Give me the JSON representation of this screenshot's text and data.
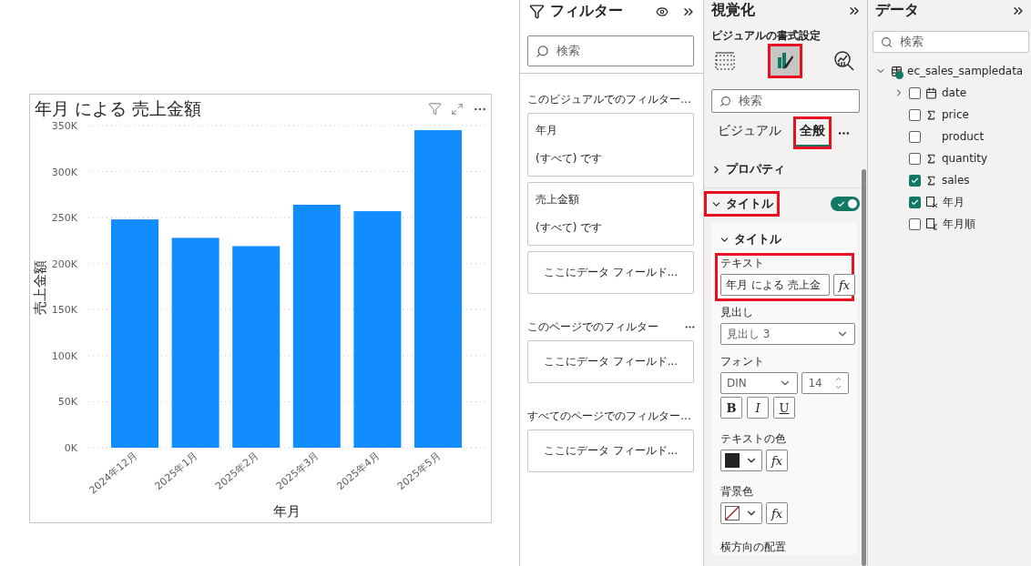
{
  "canvas": {
    "visual": {
      "title": "年月 による 売上金額",
      "chart_data": {
        "type": "bar",
        "xlabel": "年月",
        "ylabel": "売上金額",
        "categories": [
          "2024年12月",
          "2025年1月",
          "2025年2月",
          "2025年3月",
          "2025年4月",
          "2025年5月"
        ],
        "values": [
          248000,
          228000,
          219000,
          264000,
          257000,
          345000
        ],
        "grid": true,
        "ylim": [
          0,
          350000
        ],
        "yticks": [
          {
            "value": 0,
            "label": "0K"
          },
          {
            "value": 50000,
            "label": "50K"
          },
          {
            "value": 100000,
            "label": "100K"
          },
          {
            "value": 150000,
            "label": "150K"
          },
          {
            "value": 200000,
            "label": "200K"
          },
          {
            "value": 250000,
            "label": "250K"
          },
          {
            "value": 300000,
            "label": "300K"
          },
          {
            "value": 350000,
            "label": "350K"
          }
        ]
      }
    }
  },
  "filters": {
    "title": "フィルター",
    "search": {
      "placeholder": "検索"
    },
    "sections": [
      {
        "heading": "このビジュアルでのフィルター…",
        "menu": false,
        "cards": [
          {
            "kind": "filter",
            "field": "年月",
            "summary": "(すべて) です"
          },
          {
            "kind": "filter",
            "field": "売上金額",
            "summary": "(すべて) です"
          },
          {
            "kind": "drop",
            "text": "ここにデータ フィールド..."
          }
        ]
      },
      {
        "heading": "このページでのフィルター",
        "menu": true,
        "cards": [
          {
            "kind": "drop",
            "text": "ここにデータ フィールド..."
          }
        ]
      },
      {
        "heading": "すべてのページでのフィルター…",
        "menu": false,
        "cards": [
          {
            "kind": "drop",
            "text": "ここにデータ フィールド..."
          }
        ]
      }
    ]
  },
  "visualizations": {
    "title": "視覚化",
    "subtitle": "ビジュアルの書式設定",
    "modes": [
      {
        "kind": "fields",
        "selected": false,
        "highlighted": false
      },
      {
        "kind": "format",
        "selected": true,
        "highlighted": true
      },
      {
        "kind": "analytics",
        "selected": false,
        "highlighted": false
      }
    ],
    "search": {
      "placeholder": "検索"
    },
    "tabs": [
      {
        "label": "ビジュアル",
        "selected": false,
        "highlighted": false
      },
      {
        "label": "全般",
        "selected": true,
        "highlighted": true
      }
    ],
    "sections": [
      {
        "label": "プロパティ",
        "expanded": false,
        "highlighted": false
      },
      {
        "label": "タイトル",
        "expanded": true,
        "highlighted": true,
        "toggle": true
      }
    ],
    "title_card": {
      "heading": "タイトル",
      "expanded": true,
      "controls": [
        {
          "kind": "text",
          "label": "テキスト",
          "value": "年月 による 売上金",
          "fx": "fx",
          "highlighted": true
        },
        {
          "kind": "select",
          "label": "見出し",
          "value": "見出し 3"
        },
        {
          "kind": "font",
          "label": "フォント",
          "family": "DIN",
          "size": "14",
          "styles": [
            {
              "kind": "bold",
              "label": "B",
              "selected": false
            },
            {
              "kind": "italic",
              "label": "I",
              "selected": false
            },
            {
              "kind": "underline",
              "label": "U",
              "selected": false
            }
          ]
        },
        {
          "kind": "color",
          "label": "テキストの色",
          "color": "#252423",
          "fx": "fx"
        },
        {
          "kind": "nocolor",
          "label": "背景色",
          "fx": "fx"
        },
        {
          "kind": "heading",
          "label": "横方向の配置"
        }
      ]
    }
  },
  "data": {
    "title": "データ",
    "search": {
      "placeholder": "検索"
    },
    "tree": [
      {
        "label": "ec_sales_sampledata",
        "kind": "table",
        "expanded": true,
        "children": [
          {
            "label": "date",
            "kind": "date",
            "checked": false,
            "expanded": false
          },
          {
            "label": "price",
            "kind": "sum",
            "checked": false
          },
          {
            "label": "product",
            "kind": "text",
            "checked": false
          },
          {
            "label": "quantity",
            "kind": "sum",
            "checked": false
          },
          {
            "label": "sales",
            "kind": "sum",
            "checked": true
          },
          {
            "label": "年月",
            "kind": "calc",
            "checked": true
          },
          {
            "label": "年月順",
            "kind": "ordered",
            "checked": false
          }
        ]
      }
    ]
  }
}
